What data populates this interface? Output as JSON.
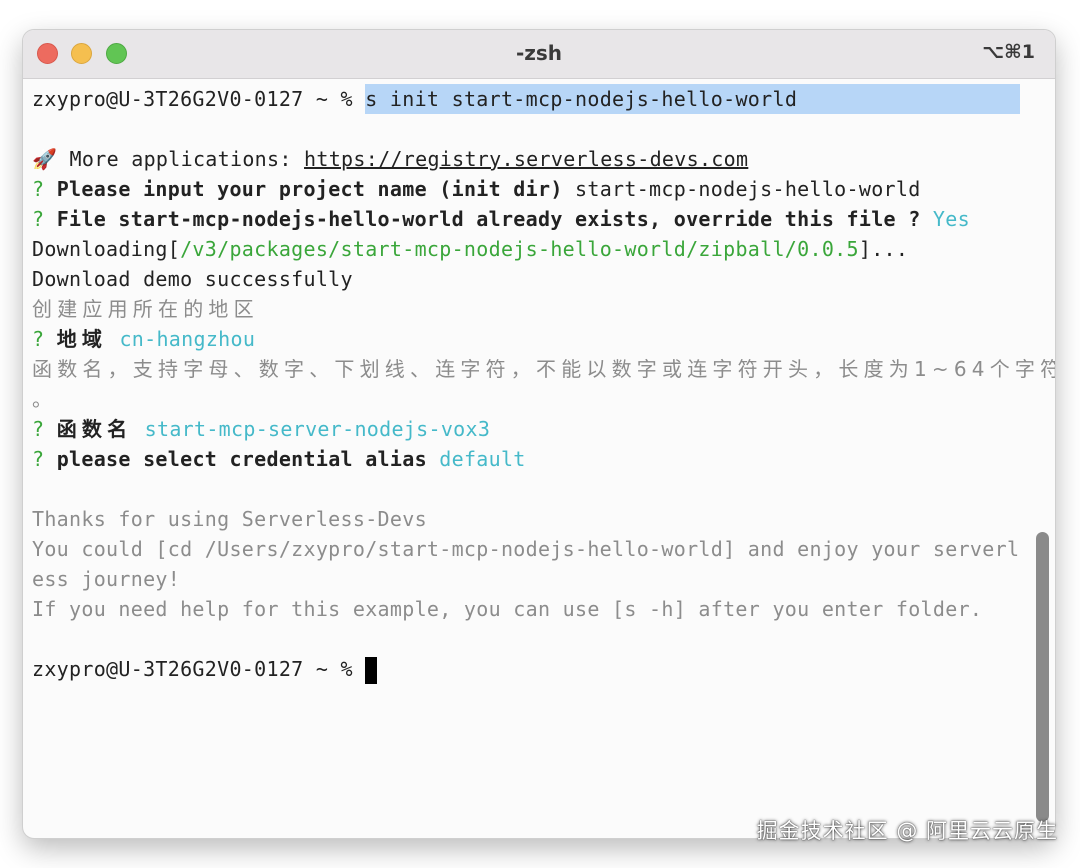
{
  "window": {
    "title": "-zsh",
    "shortcut": "⌥⌘1"
  },
  "terminal": {
    "prompt": "zxypro@U-3T26G2V0-0127 ~ % ",
    "command": "s init start-mcp-nodejs-hello-world",
    "rocket_icon": "🚀",
    "more_apps_label": " More applications: ",
    "more_apps_url": "https://registry.serverless-devs.com",
    "q_mark": "? ",
    "q1_label": "Please input your project name (init dir) ",
    "q1_answer": "start-mcp-nodejs-hello-world",
    "q2_label": "File start-mcp-nodejs-hello-world already exists, override this file ? ",
    "q2_answer": "Yes",
    "download_prefix": "Downloading[",
    "download_path": "/v3/packages/start-mcp-nodejs-hello-world/zipball/0.0.5",
    "download_suffix": "]...",
    "download_success": "Download demo successfully",
    "region_hint": "创建应用所在的地区",
    "region_label": "地域",
    "region_value": "cn-hangzhou",
    "fn_hint_1": "函数名，支持字母、数字、下划线、连字符，不能以数字或连字符开头，长度为1~64个字符",
    "fn_hint_2": "。",
    "fn_label": "函数名",
    "fn_value": "start-mcp-server-nodejs-vox3",
    "cred_label": "please select credential alias ",
    "cred_value": "default",
    "thanks": "Thanks for using Serverless-Devs",
    "could_1": "You could [cd /Users/zxypro/start-mcp-nodejs-hello-world] and enjoy your serverl",
    "could_2": "ess journey!",
    "help": "If you need help for this example, you can use [s -h] after you enter folder.",
    "final_prompt": "zxypro@U-3T26G2V0-0127 ~ % "
  },
  "watermark": "掘金技术社区 @ 阿里云云原生",
  "colors": {
    "selection": "#b7d6f7",
    "answer_cyan": "#45b9c9",
    "path_green": "#3aa63a",
    "hint_gray": "#8c8c8c"
  }
}
